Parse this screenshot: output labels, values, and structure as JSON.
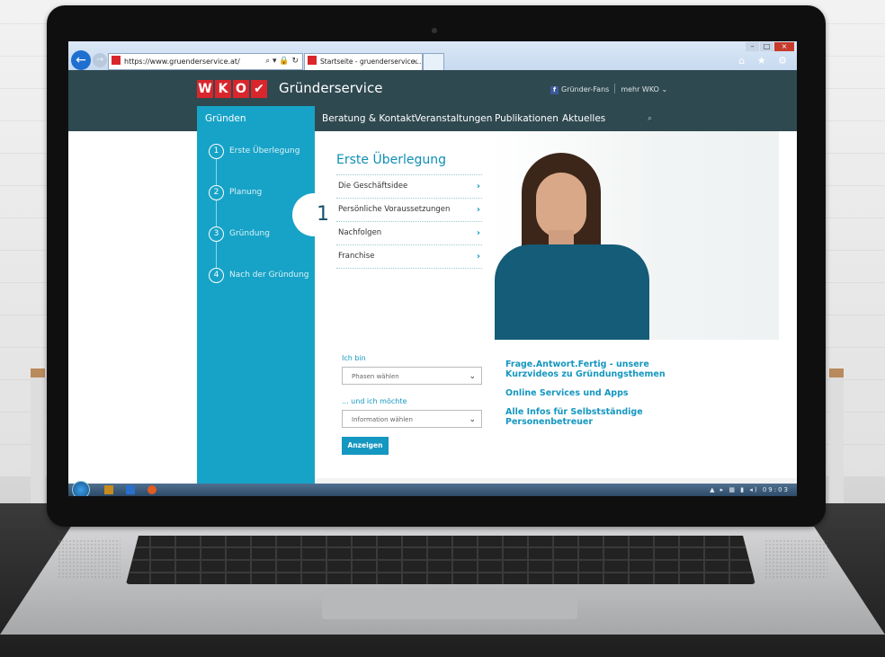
{
  "browser": {
    "url": "https://www.gruenderservice.at/",
    "tab_title": "Startseite - gruenderservice...",
    "tab_close": "×",
    "tools": "⌕ ▾ 🔒 ↻",
    "right_icons": "⌂ ★ ⚙"
  },
  "header": {
    "logo_letters": [
      "W",
      "K",
      "O",
      "✔"
    ],
    "brand": "Gründerservice",
    "fb_label": "Gründer-Fans",
    "more": "mehr WKO ⌄"
  },
  "nav": {
    "active": "Gründen",
    "items": [
      "Beratung & Kontakt",
      "Veranstaltungen",
      "Publikationen",
      "Aktuelles"
    ],
    "search_icon": "⌕"
  },
  "sidebar": {
    "steps": [
      {
        "num": "1",
        "label": "Erste Überlegung"
      },
      {
        "num": "2",
        "label": "Planung"
      },
      {
        "num": "3",
        "label": "Gründung"
      },
      {
        "num": "4",
        "label": "Nach der Gründung"
      }
    ]
  },
  "content": {
    "step_badge": "1",
    "title": "Erste Überlegung",
    "menu": [
      "Die Geschäftsidee",
      "Persönliche Voraussetzungen",
      "Nachfolgen",
      "Franchise"
    ]
  },
  "form": {
    "label1": "Ich bin",
    "select1": "Phasen wählen",
    "label2": "... und ich möchte",
    "select2": "Information wählen",
    "button": "Anzeigen"
  },
  "links": [
    "Frage.Antwort.Fertig - unsere Kurzvideos zu Gründungsthemen",
    "Online Services und Apps",
    "Alle Infos für Selbstständige Personenbetreuer"
  ],
  "taskbar": {
    "tray": "▲ ▸ ▦ ▮ ◂)",
    "clock": "09:03"
  },
  "colors": {
    "header_bg": "#2f4950",
    "accent": "#17a3c7",
    "brand_red": "#d9262c"
  }
}
